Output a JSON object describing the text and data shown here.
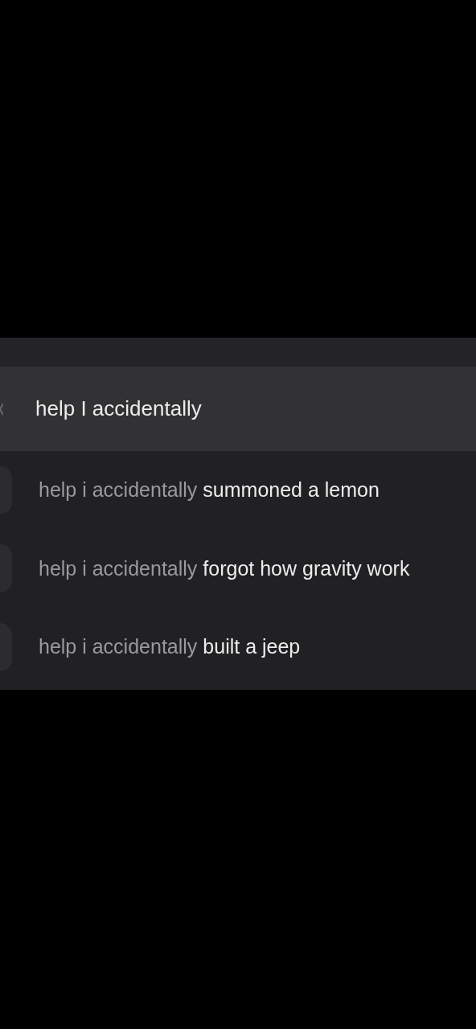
{
  "search": {
    "value": "help I accidentally"
  },
  "suggestions": [
    {
      "prefix": "help i accidentally",
      "completion": "summoned a lemon"
    },
    {
      "prefix": "help i accidentally",
      "completion": "forgot how gravity work"
    },
    {
      "prefix": "help i accidentally",
      "completion": "built a jeep"
    }
  ]
}
